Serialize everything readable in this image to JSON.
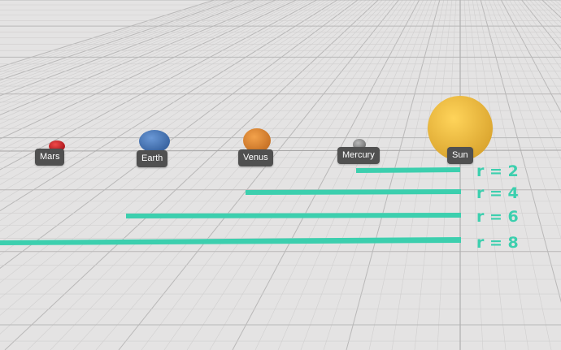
{
  "bodies": [
    {
      "key": "mars",
      "name": "Mars",
      "color": "#d8232a"
    },
    {
      "key": "earth",
      "name": "Earth",
      "color": "#4f7fc0"
    },
    {
      "key": "venus",
      "name": "Venus",
      "color": "#e08a37"
    },
    {
      "key": "mercury",
      "name": "Mercury",
      "color": "#9a9a9a"
    },
    {
      "key": "sun",
      "name": "Sun",
      "color": "#f5c445"
    }
  ],
  "radii": [
    {
      "label": "r = 2"
    },
    {
      "label": "r = 4"
    },
    {
      "label": "r = 6"
    },
    {
      "label": "r = 8"
    }
  ],
  "colors": {
    "radius_line": "#3ccfae",
    "label_bg": "#505050",
    "grid_minor": "#d0cfcf",
    "grid_major": "#b9b8b8",
    "background": "#e4e3e3"
  }
}
